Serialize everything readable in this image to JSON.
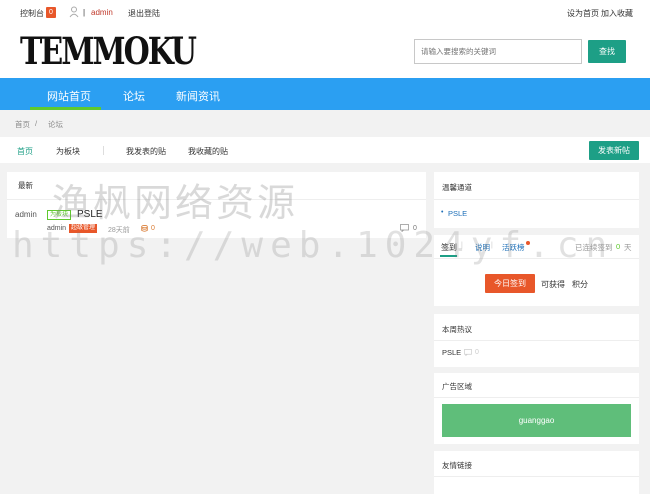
{
  "topbar": {
    "console_label": "控制台",
    "console_count": "0",
    "username": "admin",
    "logout_label": "退出登陆",
    "set_home_label": "设为首页",
    "favorite_label": "加入收藏"
  },
  "header": {
    "logo_text": "TEMMOKU",
    "search_placeholder": "请输入要搜索的关键词",
    "search_button": "查找"
  },
  "nav": {
    "items": [
      "网站首页",
      "论坛",
      "新闻资讯"
    ]
  },
  "breadcrumb": {
    "home": "首页",
    "separator": "/",
    "current": "论坛"
  },
  "subnav": {
    "home": "首页",
    "board_label": "为板块",
    "my_posts": "我发表的贴",
    "my_favorites": "我收藏的贴",
    "new_post_button": "发表新帖"
  },
  "feed": {
    "header": "最新",
    "posts": [
      {
        "author": "admin",
        "board_tag": "为板块",
        "title": "PSLE",
        "poster": "admin",
        "role_tag": "超级管理",
        "time": "28天前",
        "views": "0",
        "replies": "0"
      }
    ]
  },
  "sidebar": {
    "board_entry_title": "温馨通道",
    "board_entry_item": "PSLE",
    "signin": {
      "tab_signin": "签到",
      "tab_rules": "说明",
      "tab_active": "活跃榜",
      "streak_prefix": "已连续签到",
      "streak_days": "0",
      "streak_suffix": "天",
      "signin_button": "今日签到",
      "reward_label": "可获得",
      "points_label": "积分"
    },
    "hot_title": "本周热议",
    "hot_item": "PSLE",
    "hot_count": "0",
    "ad_title": "广告区域",
    "ad_text": "guanggao",
    "links_title": "友情链接"
  },
  "watermark": {
    "line1": "渔枫网络资源",
    "line2": "https://web.1024yf.cn"
  },
  "colors": {
    "brand_green": "#1d9f86",
    "nav_blue": "#2b9ff2",
    "accent_orange": "#e8572a",
    "tag_green": "#5fc92e"
  }
}
